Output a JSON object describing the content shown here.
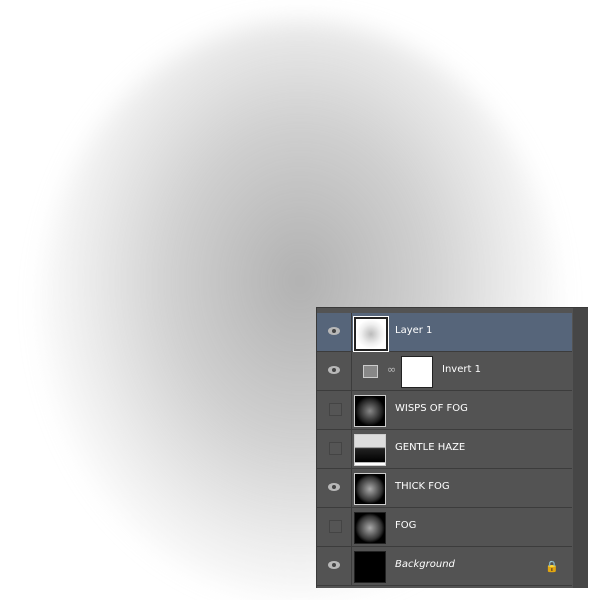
{
  "layers": [
    {
      "name": "Layer 1",
      "visible": true,
      "selected": true
    },
    {
      "name": "Invert 1",
      "visible": true,
      "adjustment": true
    },
    {
      "name": "WISPS OF FOG",
      "visible": false
    },
    {
      "name": "GENTLE HAZE",
      "visible": false
    },
    {
      "name": "THICK FOG",
      "visible": true
    },
    {
      "name": "FOG",
      "visible": false
    },
    {
      "name": "Background",
      "visible": true,
      "locked": true
    }
  ],
  "colors": {
    "panel": "#535353",
    "selected": "#56657a"
  }
}
